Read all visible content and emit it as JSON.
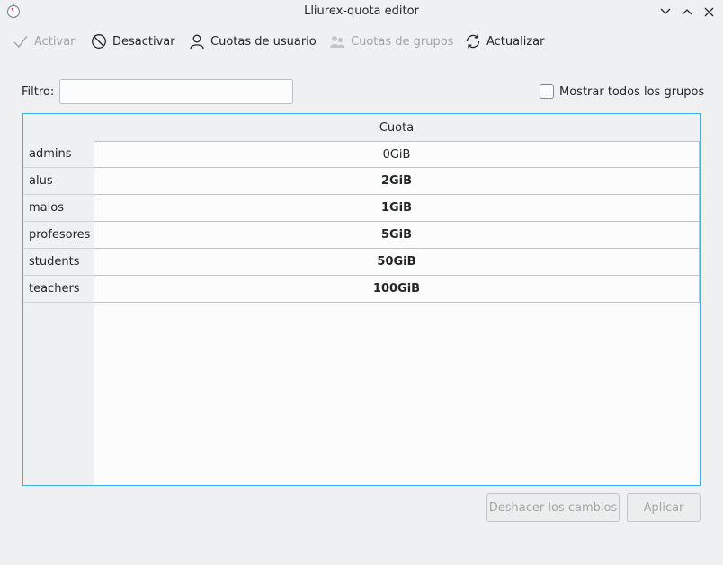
{
  "window": {
    "title": "Lliurex-quota editor",
    "icon": "stopwatch-icon"
  },
  "toolbar": {
    "activate": {
      "label": "Activar",
      "icon": "check-icon",
      "enabled": false
    },
    "deactivate": {
      "label": "Desactivar",
      "icon": "cancel-icon",
      "enabled": true
    },
    "user_quotas": {
      "label": "Cuotas de usuario",
      "icon": "user-icon",
      "enabled": true
    },
    "group_quotas": {
      "label": "Cuotas de grupos",
      "icon": "group-icon",
      "enabled": false
    },
    "refresh": {
      "label": "Actualizar",
      "icon": "refresh-icon",
      "enabled": true
    }
  },
  "filter": {
    "label": "Filtro:",
    "value": "",
    "placeholder": ""
  },
  "show_all_groups": {
    "label": "Mostrar todos los grupos",
    "checked": false
  },
  "table": {
    "column_header": "Cuota",
    "rows": [
      {
        "group": "admins",
        "quota": "0GiB"
      },
      {
        "group": "alus",
        "quota": "2GiB"
      },
      {
        "group": "malos",
        "quota": "1GiB"
      },
      {
        "group": "profesores",
        "quota": "5GiB"
      },
      {
        "group": "students",
        "quota": "50GiB"
      },
      {
        "group": "teachers",
        "quota": "100GiB"
      }
    ]
  },
  "buttons": {
    "undo": "Deshacer los cambios",
    "apply": "Aplicar"
  },
  "colors": {
    "accent": "#3daee9",
    "window_bg": "#eff0f1",
    "disabled_text": "#a3a5a7"
  }
}
